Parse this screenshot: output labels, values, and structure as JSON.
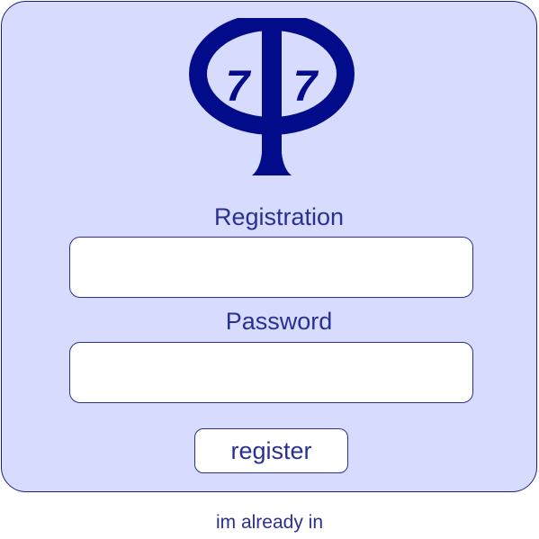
{
  "logo": {
    "icon": "phi-77-logo-icon",
    "text_left": "7",
    "text_right": "7",
    "color": "#020b8a"
  },
  "form": {
    "registration_label": "Registration",
    "registration_value": "",
    "password_label": "Password",
    "password_value": "",
    "register_button": "register"
  },
  "footer": {
    "login_link": "im already in"
  },
  "colors": {
    "card_background": "#d7dcff",
    "accent": "#2a3090",
    "logo": "#020b8a"
  }
}
